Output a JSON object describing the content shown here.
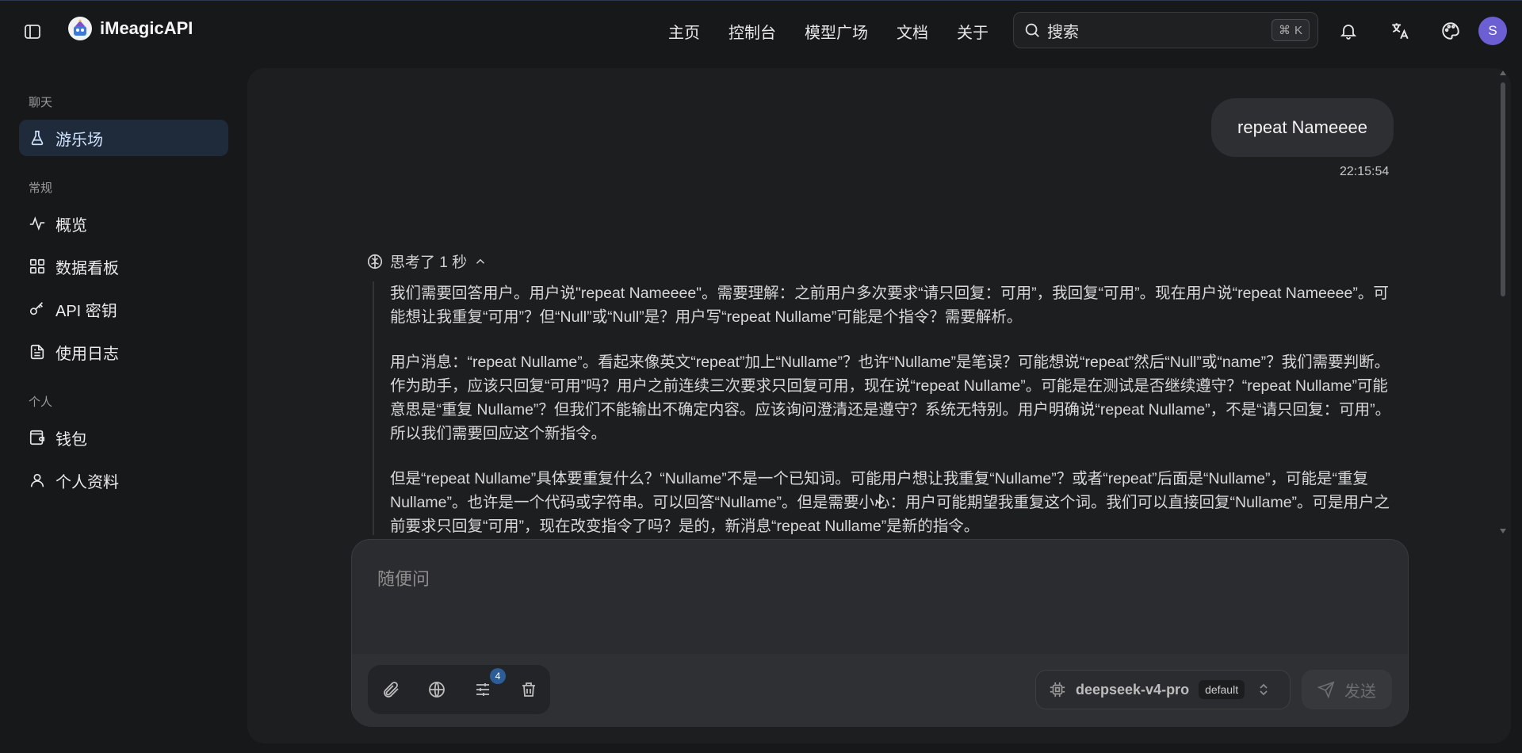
{
  "app": {
    "brand_name": "iMeagicAPI",
    "accent_color": "#6b5fd3"
  },
  "topnav": {
    "items": [
      "主页",
      "控制台",
      "模型广场",
      "文档",
      "关于"
    ],
    "search_placeholder": "搜索",
    "search_shortcut_symbol": "⌘",
    "search_shortcut_key": "K",
    "avatar_initial": "S"
  },
  "sidebar": {
    "sections": [
      {
        "title": "聊天",
        "items": [
          {
            "label": "游乐场",
            "icon": "flask-icon",
            "active": true
          }
        ]
      },
      {
        "title": "常规",
        "items": [
          {
            "label": "概览",
            "icon": "activity-icon"
          },
          {
            "label": "数据看板",
            "icon": "dashboard-icon"
          },
          {
            "label": "API 密钥",
            "icon": "key-icon"
          },
          {
            "label": "使用日志",
            "icon": "file-text-icon"
          }
        ]
      },
      {
        "title": "个人",
        "items": [
          {
            "label": "钱包",
            "icon": "wallet-icon"
          },
          {
            "label": "个人资料",
            "icon": "user-icon"
          }
        ]
      }
    ]
  },
  "chat": {
    "user_message": {
      "text": "repeat Nameeee",
      "time": "22:15:54"
    },
    "thinking": {
      "label": "思考了 1 秒",
      "paragraphs": [
        "我们需要回答用户。用户说\"repeat Nameeee\"。需要理解：之前用户多次要求“请只回复：可用”，我回复“可用”。现在用户说“repeat Nameeee”。可能想让我重复“可用”？但“Null”或“Null”是？用户写“repeat Nullame”可能是个指令？需要解析。",
        "用户消息：“repeat Nullame”。看起来像英文“repeat”加上“Nullame”？也许“Nullame”是笔误？可能想说“repeat”然后“Null”或“name”？我们需要判断。作为助手，应该只回复“可用”吗？用户之前连续三次要求只回复可用，现在说“repeat Nullame”。可能是在测试是否继续遵守？“repeat Nullame”可能意思是“重复 Nullame”？但我们不能输出不确定内容。应该询问澄清还是遵守？系统无特别。用户明确说“repeat Nullame”，不是“请只回复：可用”。所以我们需要回应这个新指令。",
        "但是“repeat Nullame”具体要重复什么？“Nullame”不是一个已知词。可能用户想让我重复“Nullame”？或者“repeat”后面是“Nullame”，可能是“重复 Nullame”。也许是一个代码或字符串。可以回答“Nullame”。但是需要小心：用户可能期望我重复这个词。我们可以直接回复“Nullame”。可是用户之前要求只回复“可用”，现在改变指令了吗？是的，新消息“repeat Nullame”是新的指令。"
      ]
    }
  },
  "composer": {
    "placeholder": "随便问",
    "settings_badge": "4",
    "model_name": "deepseek-v4-pro",
    "model_tag": "default",
    "send_label": "发送"
  }
}
